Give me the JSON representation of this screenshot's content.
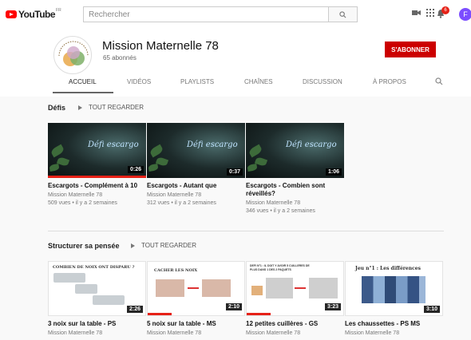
{
  "topbar": {
    "logo_word": "YouTube",
    "logo_region": "FR",
    "search_placeholder": "Rechercher",
    "icons": [
      "video-camera-icon",
      "apps-grid-icon",
      "notifications-bell-icon",
      "search-icon"
    ],
    "notification_count": "6",
    "avatar_letter": "F"
  },
  "channel": {
    "name": "Mission Maternelle 78",
    "subscribers": "65 abonnés",
    "subscribe_label": "S'ABONNER",
    "avatar_text": "Mission Maternelle des Yvelines"
  },
  "tabs": [
    "ACCUEIL",
    "VIDÉOS",
    "PLAYLISTS",
    "CHAÎNES",
    "DISCUSSION",
    "À PROPOS"
  ],
  "active_tab": "ACCUEIL",
  "sections": [
    {
      "title": "Défis",
      "play_all": "TOUT REGARDER",
      "videos": [
        {
          "title": "Escargots - Complément à 10",
          "channel": "Mission Maternelle 78",
          "meta": "509 vues • il y a 2 semaines",
          "duration": "0:26",
          "thumb_text": "Défi escargo",
          "watched": 1.0
        },
        {
          "title": "Escargots - Autant que",
          "channel": "Mission Maternelle 78",
          "meta": "312 vues • il y a 2 semaines",
          "duration": "0:37",
          "thumb_text": "Défi escargo",
          "watched": 0.0
        },
        {
          "title": "Escargots - Combien sont réveillés?",
          "channel": "Mission Maternelle 78",
          "meta": "346 vues • il y a 2 semaines",
          "duration": "1:06",
          "thumb_text": "Défi escargo",
          "watched": 0.0
        }
      ]
    },
    {
      "title": "Structurer sa pensée",
      "play_all": "TOUT REGARDER",
      "videos": [
        {
          "title": "3 noix sur la table - PS",
          "channel": "Mission Maternelle 78",
          "duration": "2:26",
          "thumb_text": "COMBIEN DE NOIX ONT DISPARU ?",
          "watched": 0.0
        },
        {
          "title": "5 noix sur la table - MS",
          "channel": "Mission Maternelle 78",
          "duration": "2:10",
          "thumb_text": "CACHER LES NOIX",
          "watched": 0.25
        },
        {
          "title": "12 petites cuillères - GS",
          "channel": "Mission Maternelle 78",
          "duration": "3:23",
          "thumb_text": "DEFI N°1 : IL DOIT Y AVOIR 5 CUILLERES DE PLUS DANS 1 DES 2 PAQUETS",
          "watched": 0.25
        },
        {
          "title": "Les chaussettes - PS MS",
          "channel": "Mission Maternelle 78",
          "duration": "3:10",
          "thumb_text": "Jeu n°1 : Les différences",
          "watched": 0.0
        }
      ]
    }
  ]
}
